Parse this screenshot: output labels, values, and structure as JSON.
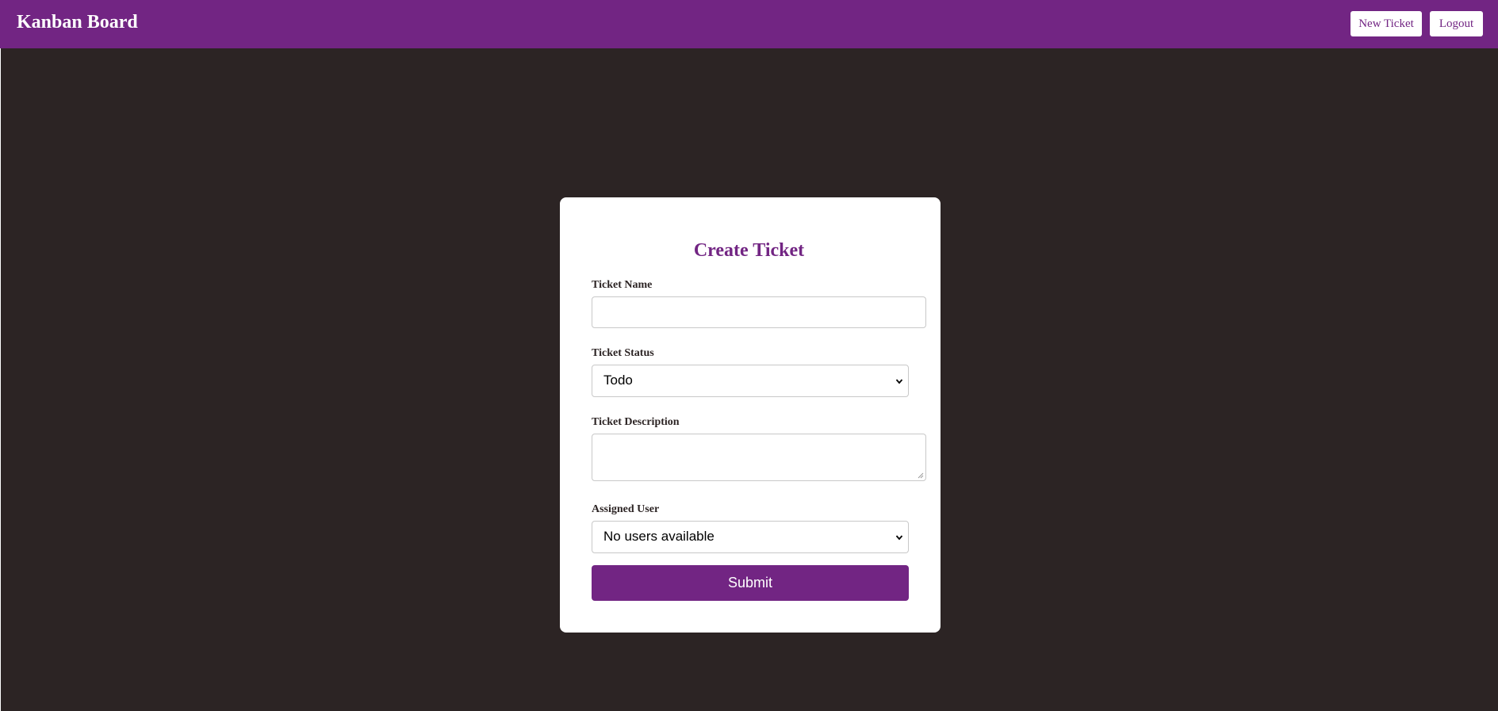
{
  "navbar": {
    "brand": "Kanban Board",
    "new_ticket_label": "New Ticket",
    "logout_label": "Logout"
  },
  "form": {
    "title": "Create Ticket",
    "ticket_name": {
      "label": "Ticket Name",
      "value": ""
    },
    "ticket_status": {
      "label": "Ticket Status",
      "selected": "Todo"
    },
    "ticket_description": {
      "label": "Ticket Description",
      "value": ""
    },
    "assigned_user": {
      "label": "Assigned User",
      "selected": "No users available"
    },
    "submit_label": "Submit"
  },
  "colors": {
    "brand_purple": "#722583",
    "background": "#2c2424",
    "card": "#ffffff"
  }
}
